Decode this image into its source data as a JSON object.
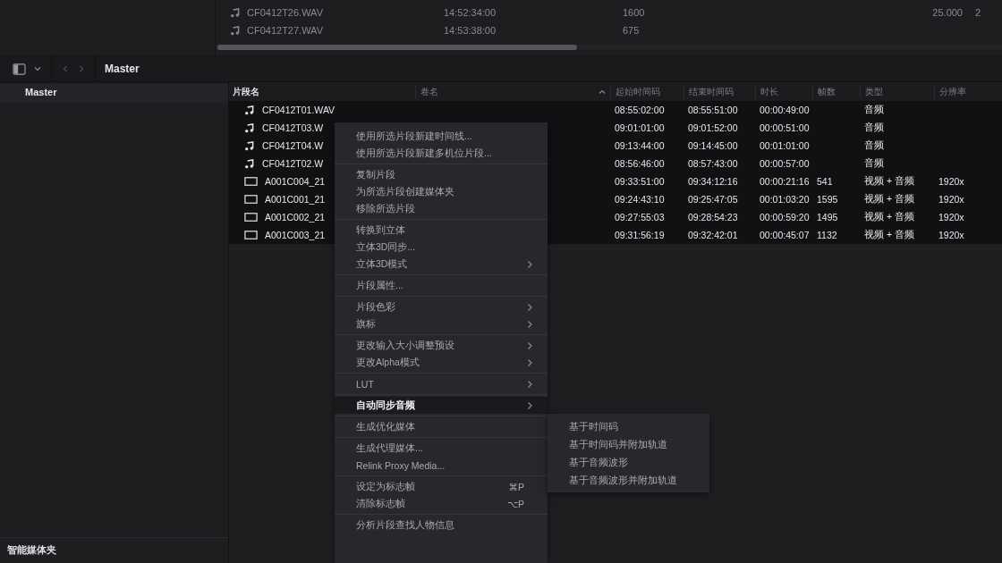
{
  "top_strip": {
    "rows": [
      {
        "kind": "audio",
        "name": "CF0412T26.WAV",
        "cells": [
          "14:52:34:00",
          "1600",
          "25.000",
          "2"
        ]
      },
      {
        "kind": "audio",
        "name": "CF0412T27.WAV",
        "cells": [
          "14:53:38:00",
          "675"
        ]
      }
    ]
  },
  "toolbar": {
    "title": "Master"
  },
  "sidebar": {
    "items": [
      {
        "label": "Master",
        "selected": true
      }
    ],
    "footer": "智能媒体夹"
  },
  "table": {
    "columns": [
      {
        "label": "片段名",
        "sorted": false
      },
      {
        "label": "卷名",
        "sorted": true
      },
      {
        "label": "起始时间码",
        "sorted": false
      },
      {
        "label": "结束时间码",
        "sorted": false
      },
      {
        "label": "时长",
        "sorted": false
      },
      {
        "label": "帧数",
        "sorted": false
      },
      {
        "label": "类型",
        "sorted": false
      },
      {
        "label": "分辨率",
        "sorted": false
      }
    ],
    "rows": [
      {
        "kind": "audio",
        "selected": true,
        "name": "CF0412T01.WAV",
        "start": "08:55:02:00",
        "end": "08:55:51:00",
        "duration": "00:00:49:00",
        "type": "音频"
      },
      {
        "kind": "audio",
        "selected": true,
        "name": "CF0412T03.W",
        "start": "09:01:01:00",
        "end": "09:01:52:00",
        "duration": "00:00:51:00",
        "type": "音频"
      },
      {
        "kind": "audio",
        "selected": true,
        "name": "CF0412T04.W",
        "start": "09:13:44:00",
        "end": "09:14:45:00",
        "duration": "00:01:01:00",
        "type": "音频"
      },
      {
        "kind": "audio",
        "selected": true,
        "name": "CF0412T02.W",
        "start": "08:56:46:00",
        "end": "08:57:43:00",
        "duration": "00:00:57:00",
        "type": "音频"
      },
      {
        "kind": "video",
        "selected": true,
        "name": "A001C004_21",
        "start": "09:33:51:00",
        "end": "09:34:12:16",
        "duration": "00:00:21:16",
        "frames": "541",
        "type": "视频 + 音频",
        "resolution": "1920x"
      },
      {
        "kind": "video",
        "selected": true,
        "name": "A001C001_21",
        "start": "09:24:43:10",
        "end": "09:25:47:05",
        "duration": "00:01:03:20",
        "frames": "1595",
        "type": "视频 + 音频",
        "resolution": "1920x"
      },
      {
        "kind": "video",
        "selected": true,
        "name": "A001C002_21",
        "start": "09:27:55:03",
        "end": "09:28:54:23",
        "duration": "00:00:59:20",
        "frames": "1495",
        "type": "视频 + 音频",
        "resolution": "1920x"
      },
      {
        "kind": "video",
        "selected": true,
        "name": "A001C003_21",
        "start": "09:31:56:19",
        "end": "09:32:42:01",
        "duration": "00:00:45:07",
        "frames": "1132",
        "type": "视频 + 音频",
        "resolution": "1920x"
      }
    ]
  },
  "context_menu": {
    "groups": [
      [
        {
          "label": "使用所选片段新建时间线...",
          "submenu": false,
          "selected": false
        },
        {
          "label": "使用所选片段新建多机位片段...",
          "submenu": false,
          "selected": false
        }
      ],
      [
        {
          "label": "复制片段",
          "submenu": false,
          "selected": false
        },
        {
          "label": "为所选片段创建媒体夹",
          "submenu": false,
          "selected": false
        },
        {
          "label": "移除所选片段",
          "submenu": false,
          "selected": false
        }
      ],
      [
        {
          "label": "转换到立体",
          "submenu": false,
          "selected": false
        },
        {
          "label": "立体3D同步...",
          "submenu": false,
          "selected": false
        },
        {
          "label": "立体3D模式",
          "submenu": true,
          "selected": false
        }
      ],
      [
        {
          "label": "片段属性...",
          "submenu": false,
          "selected": false
        }
      ],
      [
        {
          "label": "片段色彩",
          "submenu": true,
          "selected": false
        },
        {
          "label": "旗标",
          "submenu": true,
          "selected": false
        }
      ],
      [
        {
          "label": "更改输入大小调整预设",
          "submenu": true,
          "selected": false
        },
        {
          "label": "更改Alpha模式",
          "submenu": true,
          "selected": false
        }
      ],
      [
        {
          "label": "LUT",
          "submenu": true,
          "selected": false
        }
      ],
      [
        {
          "label": "自动同步音频",
          "submenu": true,
          "selected": true
        }
      ],
      [
        {
          "label": "生成优化媒体",
          "submenu": false,
          "selected": false
        }
      ],
      [
        {
          "label": "生成代理媒体...",
          "submenu": false,
          "selected": false
        },
        {
          "label": "Relink Proxy Media...",
          "submenu": false,
          "selected": false
        }
      ],
      [
        {
          "label": "设定为标志帧",
          "submenu": false,
          "selected": false,
          "shortcut": "⌘P"
        },
        {
          "label": "清除标志帧",
          "submenu": false,
          "selected": false,
          "shortcut": "⌥P"
        }
      ],
      [
        {
          "label": "分析片段查找人物信息",
          "submenu": false,
          "selected": false
        }
      ]
    ]
  },
  "submenu": {
    "items": [
      {
        "label": "基于时间码"
      },
      {
        "label": "基于时间码并附加轨道"
      },
      {
        "label": "基于音频波形"
      },
      {
        "label": "基于音频波形并附加轨道"
      }
    ]
  }
}
